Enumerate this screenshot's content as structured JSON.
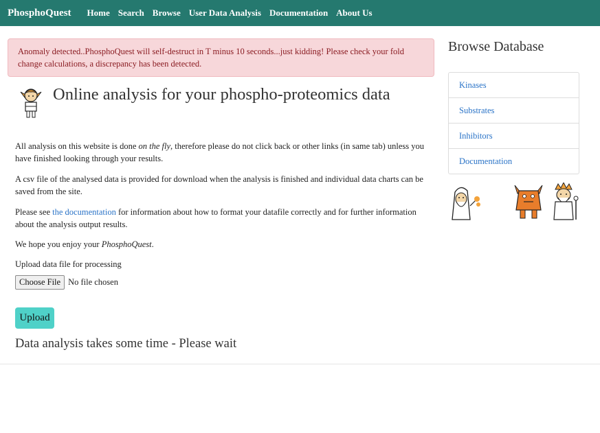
{
  "navbar": {
    "brand": "PhosphoQuest",
    "links": [
      "Home",
      "Search",
      "Browse",
      "User Data Analysis",
      "Documentation",
      "About Us"
    ],
    "color": "#25796f"
  },
  "alert": {
    "text": "Anomaly detected..PhosphoQuest will self-destruct in T minus 10 seconds...just kidding! Please check your fold change calculations, a discrepancy has been detected."
  },
  "main": {
    "title": "Online analysis for your phospho-proteomics data",
    "para1_a": "All analysis on this website is done ",
    "para1_em": "on the fly",
    "para1_b": ", therefore please do not click back or other links (in same tab) unless you have finished looking through your results.",
    "para2": "A csv file of the analysed data is provided for download when the analysis is finished and individual data charts can be saved from the site.",
    "para3_a": "Please see ",
    "para3_link": "the documentation",
    "para3_b": " for information about how to format your datafile correctly and for further information about the analysis output results.",
    "para4_a": "We hope you enjoy your ",
    "para4_em": "PhosphoQuest",
    "para4_b": ".",
    "upload_label": "Upload data file for processing",
    "choose_file_label": "Choose File",
    "file_status": "No file chosen",
    "upload_button": "Upload",
    "upload_button_color": "#4fd1c8",
    "wait_text": "Data analysis takes some time - Please wait"
  },
  "sidebar": {
    "heading": "Browse Database",
    "items": [
      "Kinases",
      "Substrates",
      "Inhibitors",
      "Documentation"
    ]
  },
  "icons": [
    "elf-character-icon",
    "wizard-character-icon",
    "monster-character-icon",
    "old-wizard-character-icon"
  ]
}
